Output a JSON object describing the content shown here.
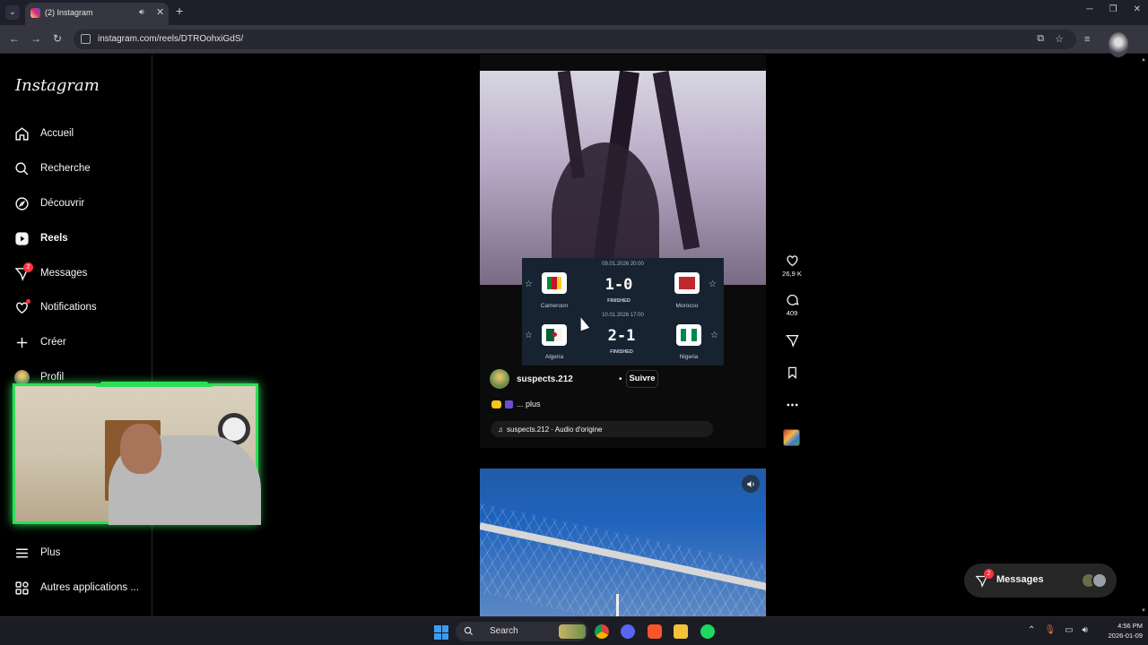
{
  "browser": {
    "tab_title": "(2) Instagram",
    "url": "instagram.com/reels/DTROohxiGdS/"
  },
  "sidebar": {
    "logo": "Instagram",
    "items": [
      {
        "label": "Accueil",
        "icon": "home-icon"
      },
      {
        "label": "Recherche",
        "icon": "search-icon"
      },
      {
        "label": "Découvrir",
        "icon": "compass-icon"
      },
      {
        "label": "Reels",
        "icon": "reels-icon"
      },
      {
        "label": "Messages",
        "icon": "messenger-icon",
        "badge": "2"
      },
      {
        "label": "Notifications",
        "icon": "heart-icon"
      },
      {
        "label": "Créer",
        "icon": "plus-icon"
      },
      {
        "label": "Profil",
        "icon": "avatar"
      },
      {
        "label": "Plus",
        "icon": "menu-icon"
      },
      {
        "label": "Autres applications ...",
        "icon": "apps-icon"
      }
    ]
  },
  "reel": {
    "scoreboard": {
      "match1": {
        "date": "09.01.2026 20:00",
        "home": "Cameroon",
        "away": "Morocco",
        "score": "1-0",
        "status": "FINISHED"
      },
      "match2": {
        "date": "10.01.2026 17:00",
        "home": "Algeria",
        "away": "Nigeria",
        "score": "2-1",
        "status": "FINISHED"
      }
    },
    "username": "suspects.212",
    "follow_label": "Suivre",
    "caption_more": "... plus",
    "audio": "suspects.212 · Audio d'origine"
  },
  "actions": {
    "likes": "26,9 K",
    "comments": "409"
  },
  "messages_pill": {
    "label": "Messages",
    "badge": "2"
  },
  "taskbar": {
    "search_label": "Search",
    "time": "4:56 PM",
    "date": "2026-01-09"
  },
  "colors": {
    "accent_red": "#ff3040",
    "webcam_border": "#2cdf57"
  }
}
